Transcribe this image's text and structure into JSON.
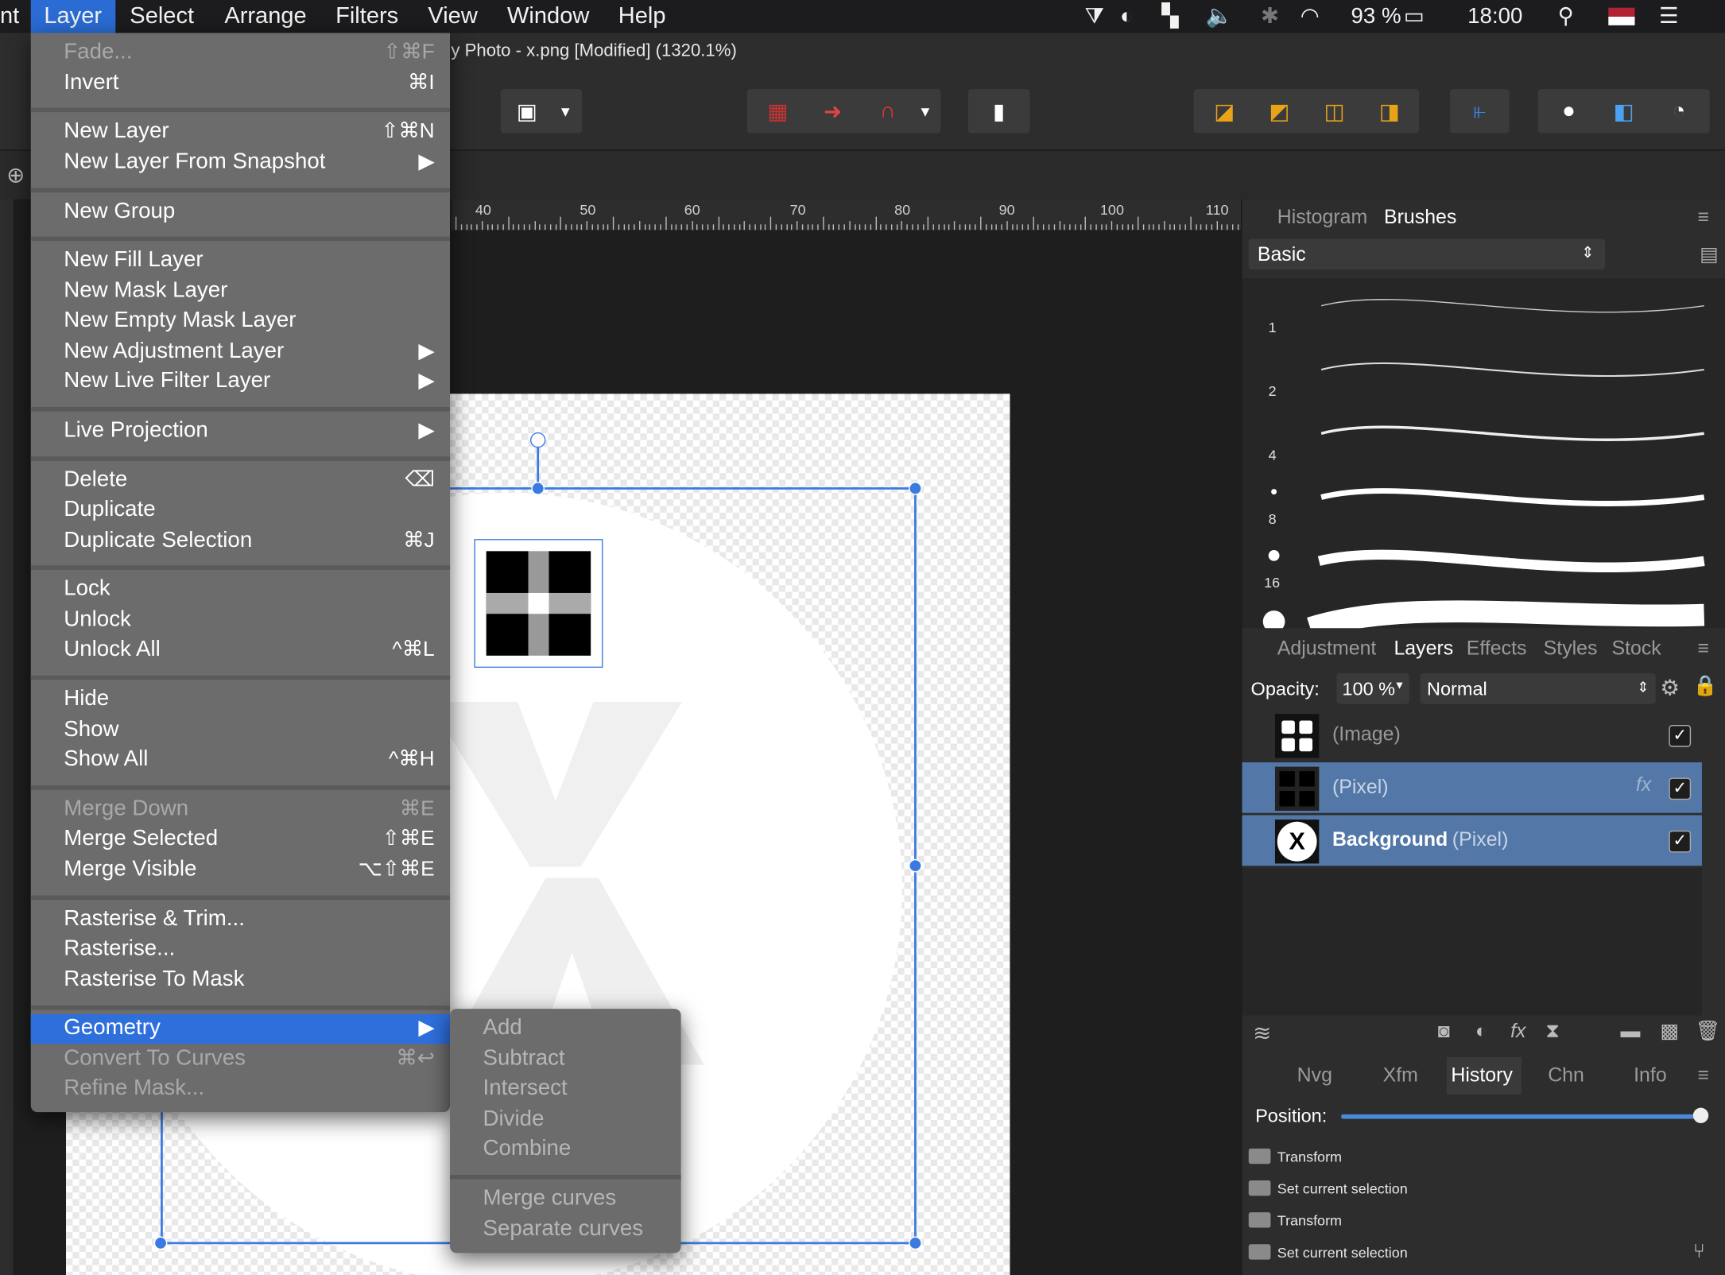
{
  "menubar": {
    "app_fragment": "nt",
    "items": [
      "Layer",
      "Select",
      "Arrange",
      "Filters",
      "View",
      "Window",
      "Help"
    ],
    "battery": "93 %",
    "clock": "18:00"
  },
  "window": {
    "title": "y Photo - x.png [Modified] (1320.1%)"
  },
  "ruler": {
    "labels": [
      "40",
      "50",
      "60",
      "70",
      "80",
      "90",
      "100",
      "110"
    ]
  },
  "layer_menu": {
    "items": [
      {
        "label": "Fade...",
        "shortcut": "⇧⌘F",
        "disabled": true
      },
      {
        "label": "Invert",
        "shortcut": "⌘I"
      },
      {
        "label": "New Layer",
        "shortcut": "⇧⌘N"
      },
      {
        "label": "New Layer From Snapshot",
        "shortcut": "▶"
      },
      {
        "label": "New Group",
        "shortcut": ""
      },
      {
        "label": "New Fill Layer",
        "shortcut": ""
      },
      {
        "label": "New Mask Layer",
        "shortcut": ""
      },
      {
        "label": "New Empty Mask Layer",
        "shortcut": ""
      },
      {
        "label": "New Adjustment Layer",
        "shortcut": "▶"
      },
      {
        "label": "New Live Filter Layer",
        "shortcut": "▶"
      },
      {
        "label": "Live Projection",
        "shortcut": "▶"
      },
      {
        "label": "Delete",
        "shortcut": "⌫"
      },
      {
        "label": "Duplicate",
        "shortcut": ""
      },
      {
        "label": "Duplicate Selection",
        "shortcut": "⌘J"
      },
      {
        "label": "Lock",
        "shortcut": ""
      },
      {
        "label": "Unlock",
        "shortcut": ""
      },
      {
        "label": "Unlock All",
        "shortcut": "^⌘L"
      },
      {
        "label": "Hide",
        "shortcut": ""
      },
      {
        "label": "Show",
        "shortcut": ""
      },
      {
        "label": "Show All",
        "shortcut": "^⌘H"
      },
      {
        "label": "Merge Down",
        "shortcut": "⌘E",
        "disabled": true
      },
      {
        "label": "Merge Selected",
        "shortcut": "⇧⌘E"
      },
      {
        "label": "Merge Visible",
        "shortcut": "⌥⇧⌘E"
      },
      {
        "label": "Rasterise & Trim...",
        "shortcut": ""
      },
      {
        "label": "Rasterise...",
        "shortcut": ""
      },
      {
        "label": "Rasterise To Mask",
        "shortcut": ""
      },
      {
        "label": "Geometry",
        "shortcut": "▶",
        "highlighted": true
      },
      {
        "label": "Convert To Curves",
        "shortcut": "⌘↩",
        "disabled": true
      },
      {
        "label": "Refine Mask...",
        "shortcut": "",
        "disabled": true
      }
    ]
  },
  "geometry_submenu": {
    "items": [
      "Add",
      "Subtract",
      "Intersect",
      "Divide",
      "Combine",
      "Merge curves",
      "Separate curves"
    ]
  },
  "brushes_panel": {
    "tabs": [
      "Histogram",
      "Brushes"
    ],
    "active_tab": "Brushes",
    "category": "Basic",
    "stroke_sizes": [
      "1",
      "2",
      "4",
      "8",
      "16"
    ]
  },
  "layers_panel": {
    "tabs": [
      "Adjustment",
      "Layers",
      "Effects",
      "Styles",
      "Stock"
    ],
    "active_tab": "Layers",
    "opacity_label": "Opacity:",
    "opacity_value": "100 %",
    "blend_mode": "Normal",
    "layers": [
      {
        "name": "",
        "type": "(Image)",
        "selected": false
      },
      {
        "name": "",
        "type": "(Pixel)",
        "selected": true
      },
      {
        "name": "Background",
        "type": "(Pixel)",
        "selected": true
      }
    ]
  },
  "history_panel": {
    "tabs": [
      "Nvg",
      "Xfm",
      "History",
      "Chn",
      "Info"
    ],
    "active_tab": "History",
    "position_label": "Position:",
    "entries": [
      "Transform",
      "Set current selection",
      "Transform",
      "Set current selection"
    ]
  },
  "colors": {
    "accent": "#2e6fdc",
    "selection": "#3b7be0",
    "layer_selected": "#5377a6"
  }
}
